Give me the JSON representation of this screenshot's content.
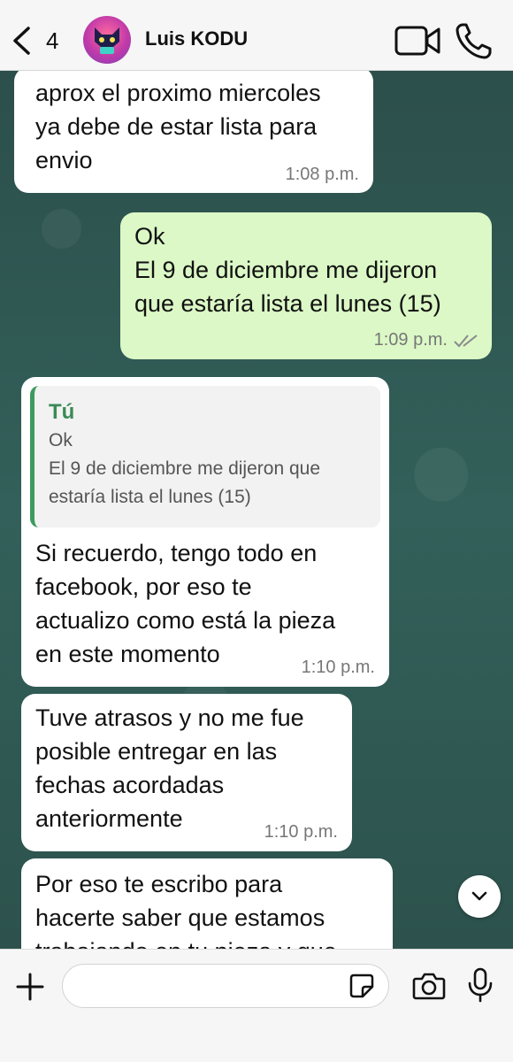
{
  "header": {
    "back_count": "4",
    "contact_name": "Luis KODU",
    "icons": [
      "chevron-left-icon",
      "video-camera-icon",
      "phone-icon"
    ]
  },
  "messages": [
    {
      "direction": "incoming",
      "text": "aprox el proximo miercoles\nya debe de estar lista para\nenvio",
      "time": "1:08 p.m."
    },
    {
      "direction": "outgoing",
      "text": "Ok\nEl 9 de diciembre me dijeron\nque estaría lista el lunes (15)",
      "time": "1:09 p.m.",
      "status": "read-double-check"
    },
    {
      "direction": "incoming",
      "quote": {
        "author": "Tú",
        "text": "Ok\nEl 9 de diciembre me dijeron que\nestaría lista el lunes (15)"
      },
      "text": "Si recuerdo, tengo todo en\nfacebook, por eso te\nactualizo como está la pieza\nen este momento",
      "time": "1:10 p.m."
    },
    {
      "direction": "incoming",
      "text": "Tuve atrasos y no me fue\nposible entregar en las\nfechas acordadas\nanteriormente",
      "time": "1:10 p.m."
    },
    {
      "direction": "incoming",
      "text": "Por eso te escribo para\nhacerte saber que estamos\ntrabajando en tu pieza y que",
      "time": ""
    }
  ],
  "composer": {
    "input_value": "",
    "icons": [
      "plus-icon",
      "sticker-icon",
      "camera-icon",
      "microphone-icon"
    ]
  },
  "colors": {
    "incoming_bubble": "#ffffff",
    "outgoing_bubble": "#dbf8c6",
    "quote_accent": "#3d9a5f",
    "wallpaper": "#2e5551",
    "read_ticks": "#8a8a8a"
  }
}
